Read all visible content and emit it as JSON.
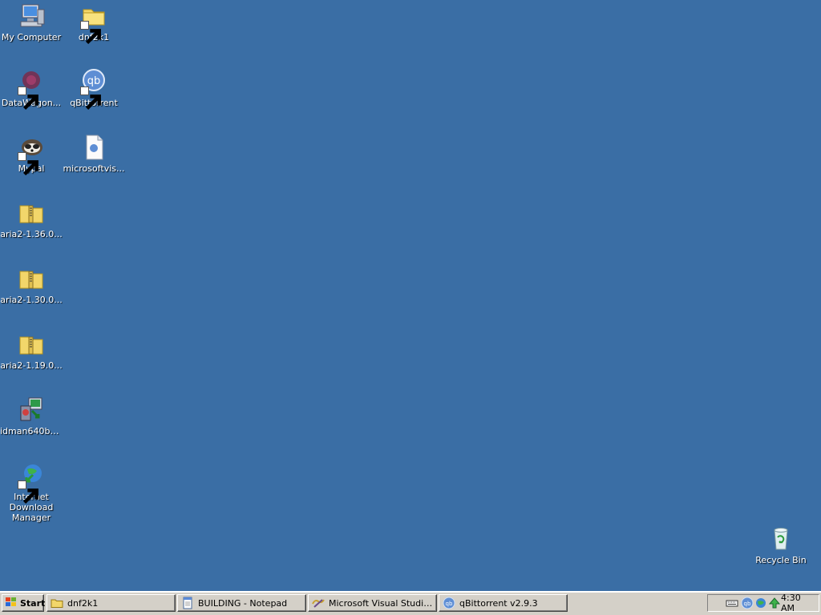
{
  "desktop": {
    "background_color": "#3a6ea5",
    "icons": [
      {
        "label": "My Computer",
        "icon": "my-computer-icon"
      },
      {
        "label": "dnf2k1",
        "icon": "folder-shortcut-icon"
      },
      {
        "label": "DataWagon...",
        "icon": "datawagon-icon"
      },
      {
        "label": "qBittorrent",
        "icon": "qbittorrent-icon"
      },
      {
        "label": "Mypal",
        "icon": "mypal-icon"
      },
      {
        "label": "microsoftvis...",
        "icon": "document-icon"
      },
      {
        "label": "aria2-1.36.0...",
        "icon": "zip-folder-icon"
      },
      {
        "label": "aria2-1.30.0...",
        "icon": "zip-folder-icon"
      },
      {
        "label": "aria2-1.19.0...",
        "icon": "zip-folder-icon"
      },
      {
        "label": "idman640buil...",
        "icon": "installer-icon"
      },
      {
        "label": "Internet Download Manager",
        "icon": "idm-icon"
      },
      {
        "label": "Recycle Bin",
        "icon": "recycle-bin-icon"
      }
    ]
  },
  "taskbar": {
    "start_label": "Start",
    "buttons": [
      {
        "label": "dnf2k1",
        "icon": "folder-icon"
      },
      {
        "label": "BUILDING - Notepad",
        "icon": "notepad-icon"
      },
      {
        "label": "Microsoft Visual Studio 6....",
        "icon": "visual-studio-icon"
      },
      {
        "label": "qBittorrent v2.9.3",
        "icon": "qbittorrent-icon"
      }
    ],
    "tray": {
      "icons": [
        "keyboard-icon",
        "qbittorrent-tray-icon",
        "network-icon",
        "network-activity-icon"
      ],
      "clock": "4:30 AM"
    }
  }
}
